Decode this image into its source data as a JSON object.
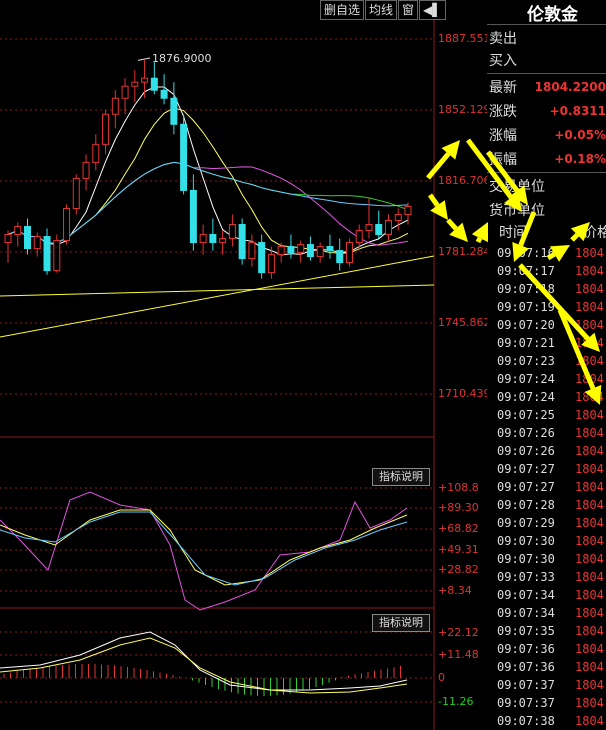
{
  "toolbar": {
    "delete_watch_label": "删自选",
    "ma_label": "均线",
    "window_label": "窗",
    "arrow_glyph": "◀▌"
  },
  "price_axis": [
    "1887.551",
    "1852.129",
    "1816.706",
    "1781.284",
    "1745.862",
    "1710.439"
  ],
  "peak_label": "1876.9000",
  "indicator1": {
    "button": "指标说明",
    "ticks": [
      "+108.8",
      "+89.30",
      "+68.82",
      "+49.31",
      "+28.82",
      "+8.34"
    ]
  },
  "indicator2": {
    "button": "指标说明",
    "ticks": [
      "+22.12",
      "+11.48",
      "0",
      "-11.26"
    ]
  },
  "quote_panel": {
    "title": "伦敦金",
    "sell_label": "卖出",
    "buy_label": "买入",
    "latest_label": "最新",
    "latest_value": "1804.2200",
    "change_label": "涨跌",
    "change_value": "+0.8311",
    "change_pct_label": "涨幅",
    "change_pct_value": "+0.05%",
    "amplitude_label": "振幅",
    "amplitude_value": "+0.18%",
    "trade_unit_label": "交易单位",
    "currency_unit_label": "货币单位",
    "time_header": "时间",
    "price_header": "价格"
  },
  "ticks": [
    {
      "time": "09:07:16",
      "price": "1804."
    },
    {
      "time": "09:07:17",
      "price": "1804."
    },
    {
      "time": "09:07:18",
      "price": "1804."
    },
    {
      "time": "09:07:19",
      "price": "1804."
    },
    {
      "time": "09:07:20",
      "price": "1804."
    },
    {
      "time": "09:07:21",
      "price": "1804."
    },
    {
      "time": "09:07:23",
      "price": "1804."
    },
    {
      "time": "09:07:24",
      "price": "1804."
    },
    {
      "time": "09:07:24",
      "price": "1804."
    },
    {
      "time": "09:07:25",
      "price": "1804."
    },
    {
      "time": "09:07:26",
      "price": "1804."
    },
    {
      "time": "09:07:26",
      "price": "1804."
    },
    {
      "time": "09:07:27",
      "price": "1804."
    },
    {
      "time": "09:07:27",
      "price": "1804."
    },
    {
      "time": "09:07:28",
      "price": "1804."
    },
    {
      "time": "09:07:29",
      "price": "1804."
    },
    {
      "time": "09:07:30",
      "price": "1804."
    },
    {
      "time": "09:07:30",
      "price": "1804."
    },
    {
      "time": "09:07:33",
      "price": "1804."
    },
    {
      "time": "09:07:34",
      "price": "1804."
    },
    {
      "time": "09:07:34",
      "price": "1804."
    },
    {
      "time": "09:07:35",
      "price": "1804."
    },
    {
      "time": "09:07:36",
      "price": "1804."
    },
    {
      "time": "09:07:36",
      "price": "1804."
    },
    {
      "time": "09:07:37",
      "price": "1804."
    },
    {
      "time": "09:07:37",
      "price": "1804."
    },
    {
      "time": "09:07:38",
      "price": "1804."
    }
  ],
  "colors": {
    "up": "#e33333",
    "down": "#33e0e8",
    "ma5": "#ffffff",
    "ma10": "#ffff66",
    "ma20": "#e055e0",
    "ma60": "#33cc33",
    "ma_long": "#66ccff",
    "trend": "#ffff33",
    "arrow": "#ffff00",
    "grid": "#8b1a1a"
  },
  "chart_data": {
    "type": "candlestick",
    "ylim": [
      1695,
      1900
    ],
    "candles": [
      {
        "o": 1786,
        "h": 1792,
        "l": 1776,
        "c": 1790
      },
      {
        "o": 1790,
        "h": 1796,
        "l": 1784,
        "c": 1794
      },
      {
        "o": 1794,
        "h": 1798,
        "l": 1780,
        "c": 1783
      },
      {
        "o": 1783,
        "h": 1791,
        "l": 1779,
        "c": 1789
      },
      {
        "o": 1789,
        "h": 1793,
        "l": 1770,
        "c": 1772
      },
      {
        "o": 1772,
        "h": 1790,
        "l": 1771,
        "c": 1787
      },
      {
        "o": 1787,
        "h": 1805,
        "l": 1785,
        "c": 1803
      },
      {
        "o": 1803,
        "h": 1820,
        "l": 1800,
        "c": 1818
      },
      {
        "o": 1818,
        "h": 1830,
        "l": 1812,
        "c": 1826
      },
      {
        "o": 1826,
        "h": 1840,
        "l": 1822,
        "c": 1835
      },
      {
        "o": 1835,
        "h": 1852,
        "l": 1830,
        "c": 1850
      },
      {
        "o": 1850,
        "h": 1862,
        "l": 1843,
        "c": 1858
      },
      {
        "o": 1858,
        "h": 1868,
        "l": 1850,
        "c": 1864
      },
      {
        "o": 1864,
        "h": 1872,
        "l": 1856,
        "c": 1866
      },
      {
        "o": 1866,
        "h": 1877,
        "l": 1858,
        "c": 1868
      },
      {
        "o": 1868,
        "h": 1876,
        "l": 1860,
        "c": 1862
      },
      {
        "o": 1862,
        "h": 1870,
        "l": 1855,
        "c": 1858
      },
      {
        "o": 1858,
        "h": 1866,
        "l": 1840,
        "c": 1845
      },
      {
        "o": 1845,
        "h": 1850,
        "l": 1810,
        "c": 1812
      },
      {
        "o": 1812,
        "h": 1820,
        "l": 1782,
        "c": 1786
      },
      {
        "o": 1786,
        "h": 1795,
        "l": 1780,
        "c": 1790
      },
      {
        "o": 1790,
        "h": 1798,
        "l": 1782,
        "c": 1786
      },
      {
        "o": 1786,
        "h": 1792,
        "l": 1780,
        "c": 1788
      },
      {
        "o": 1788,
        "h": 1800,
        "l": 1784,
        "c": 1795
      },
      {
        "o": 1795,
        "h": 1798,
        "l": 1775,
        "c": 1778
      },
      {
        "o": 1778,
        "h": 1790,
        "l": 1774,
        "c": 1786
      },
      {
        "o": 1786,
        "h": 1790,
        "l": 1768,
        "c": 1771
      },
      {
        "o": 1771,
        "h": 1784,
        "l": 1768,
        "c": 1780
      },
      {
        "o": 1780,
        "h": 1786,
        "l": 1776,
        "c": 1784
      },
      {
        "o": 1784,
        "h": 1790,
        "l": 1778,
        "c": 1781
      },
      {
        "o": 1781,
        "h": 1787,
        "l": 1776,
        "c": 1785
      },
      {
        "o": 1785,
        "h": 1789,
        "l": 1777,
        "c": 1779
      },
      {
        "o": 1779,
        "h": 1786,
        "l": 1776,
        "c": 1784
      },
      {
        "o": 1784,
        "h": 1790,
        "l": 1778,
        "c": 1782
      },
      {
        "o": 1782,
        "h": 1788,
        "l": 1772,
        "c": 1776
      },
      {
        "o": 1776,
        "h": 1788,
        "l": 1774,
        "c": 1786
      },
      {
        "o": 1786,
        "h": 1795,
        "l": 1782,
        "c": 1792
      },
      {
        "o": 1792,
        "h": 1808,
        "l": 1788,
        "c": 1795
      },
      {
        "o": 1795,
        "h": 1802,
        "l": 1788,
        "c": 1790
      },
      {
        "o": 1790,
        "h": 1800,
        "l": 1787,
        "c": 1797
      },
      {
        "o": 1797,
        "h": 1803,
        "l": 1792,
        "c": 1800
      },
      {
        "o": 1800,
        "h": 1806,
        "l": 1795,
        "c": 1804
      }
    ],
    "peak": 1876.9
  }
}
